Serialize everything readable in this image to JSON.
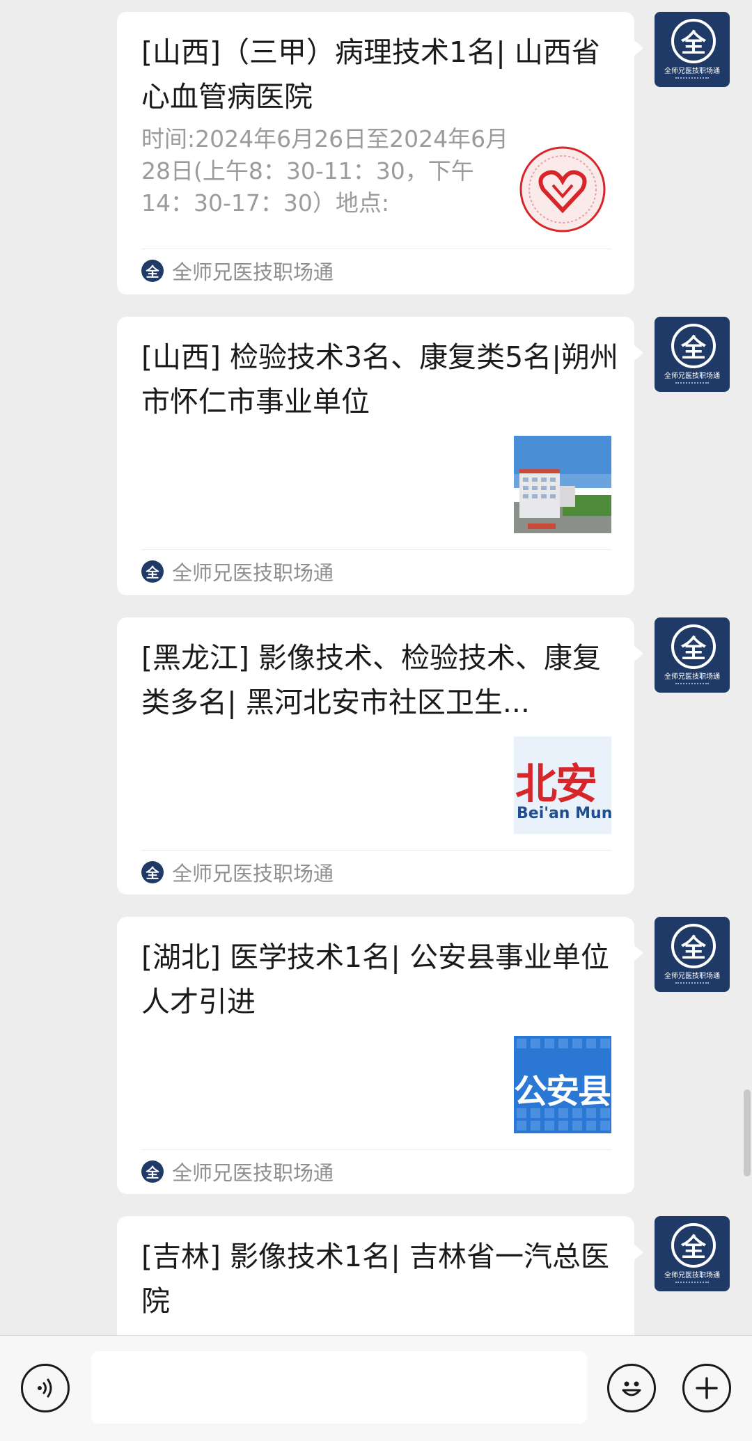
{
  "messages": [
    {
      "title": "[山西]（三甲）病理技术1名| 山西省心血管病医院",
      "desc": "时间:2024年6月26日至2024年6月28日(上午8：30-11：30，下午14：30-17：30）地点:",
      "source": "全师兄医技职场通"
    },
    {
      "title": "[山西] 检验技术3名、康复类5名|朔州市怀仁市事业单位",
      "desc": "",
      "source": "全师兄医技职场通"
    },
    {
      "title": "[黑龙江] 影像技术、检验技术、康复类多名| 黑河北安市社区卫生...",
      "desc": "",
      "thumb_text": "北安",
      "thumb_sub": "Bei'an Mun",
      "source": "全师兄医技职场通"
    },
    {
      "title": "[湖北] 医学技术1名| 公安县事业单位人才引进",
      "desc": "",
      "thumb_text": "公安县",
      "source": "全师兄医技职场通"
    },
    {
      "title": "[吉林] 影像技术1名| 吉林省一汽总医院",
      "desc": ""
    }
  ],
  "avatar": {
    "glyph": "全",
    "caption": "全师兄医技职场通"
  },
  "source_logo_glyph": "全",
  "icons": {
    "voice": "voice-icon",
    "emoji": "emoji-icon",
    "more": "plus-icon"
  },
  "colors": {
    "background": "#ededed",
    "avatar": "#1f3a66",
    "thumb_red": "#d7262a",
    "thumb_blue": "#2a78d4"
  }
}
